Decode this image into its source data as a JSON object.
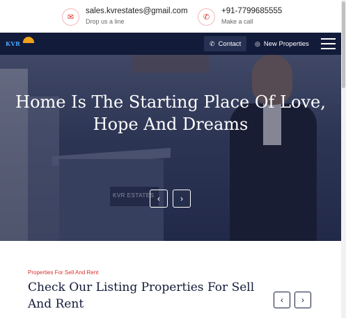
{
  "topbar": {
    "email": {
      "icon": "mail-icon",
      "value": "sales.kvrestates@gmail.com",
      "label": "Drop us a line"
    },
    "phone": {
      "icon": "phone-icon",
      "value": "+91-7799685555",
      "label": "Make a call"
    }
  },
  "navbar": {
    "logo_text": "KVR",
    "contact_label": "Contact",
    "contact_icon": "phone-icon",
    "properties_label": "New Properties",
    "properties_icon": "target-icon",
    "menu_icon": "hamburger-menu-icon"
  },
  "hero": {
    "title": "Home Is The Starting Place Of Love, Hope And Dreams",
    "sign_text": "KVR ESTATES",
    "prev_icon": "chevron-left-icon",
    "next_icon": "chevron-right-icon"
  },
  "listing": {
    "kicker": "Properties For Sell And Rent",
    "title": "Check Our Listing Properties For Sell And Rent",
    "prev_icon": "chevron-left-icon",
    "next_icon": "chevron-right-icon"
  },
  "colors": {
    "navy": "#131b3a",
    "accent_red": "#d9302c",
    "white": "#ffffff"
  }
}
